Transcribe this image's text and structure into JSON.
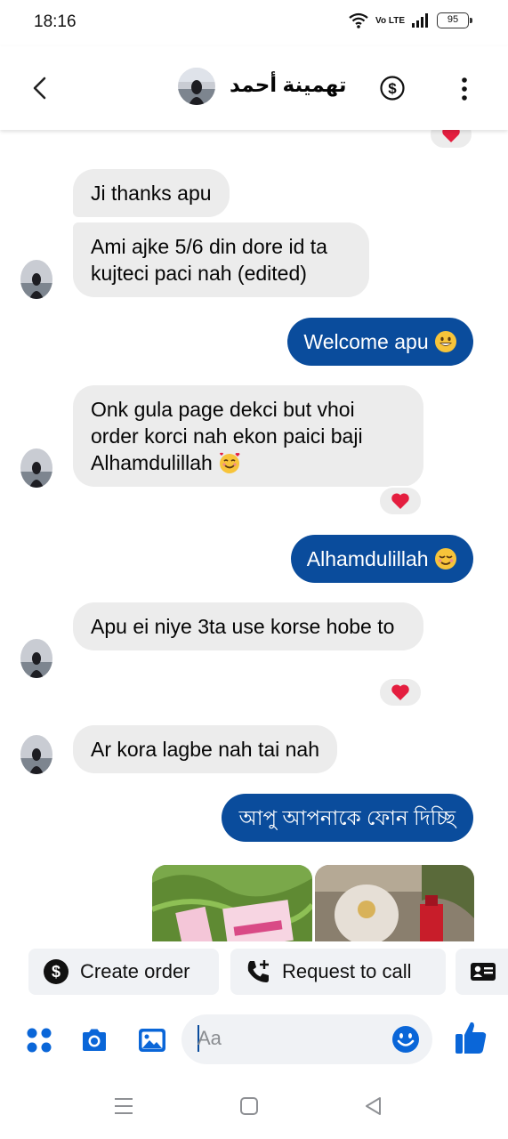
{
  "status_bar": {
    "time": "18:16",
    "network": "Vo LTE",
    "battery": "95"
  },
  "header": {
    "contact_name": "تهمينة أحمد"
  },
  "messages": [
    {
      "direction": "out",
      "text": "",
      "reaction": "heart"
    },
    {
      "direction": "in",
      "text": "Ji thanks apu"
    },
    {
      "direction": "in",
      "text": "Ami ajke 5/6 din dore id ta kujteci paci nah (edited)"
    },
    {
      "direction": "out",
      "text": "Welcome apu",
      "emoji": "grinning-face"
    },
    {
      "direction": "in",
      "text": "Onk gula page dekci but vhoi order korci nah ekon paici baji Alhamdulillah",
      "emoji": "smiling-face-with-hearts",
      "reaction": "heart"
    },
    {
      "direction": "out",
      "text": "Alhamdulillah",
      "emoji": "relieved-face"
    },
    {
      "direction": "in",
      "text": "Apu ei niye 3ta use korse hobe to",
      "reaction": "heart"
    },
    {
      "direction": "in",
      "text": "Ar kora lagbe nah tai nah"
    },
    {
      "direction": "out",
      "text": "আপু আপনাকে ফোন দিচ্ছি"
    }
  ],
  "chips": {
    "create_order": "Create order",
    "request_call": "Request to call"
  },
  "composer": {
    "placeholder": "Aa"
  },
  "colors": {
    "outgoing": "#0a4c9c",
    "incoming": "#ececec",
    "icons": "#0a66d8",
    "reaction_heart": "#e41e3f"
  }
}
